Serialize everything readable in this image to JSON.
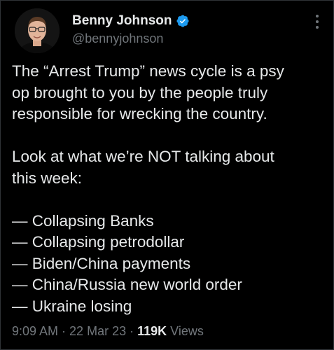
{
  "author": {
    "display_name": "Benny Johnson",
    "handle": "@bennyjohnson",
    "verified": true,
    "verified_color": "#1d9bf0"
  },
  "tweet": {
    "paragraph1": [
      "The “Arrest Trump” news cycle is a psy",
      "op brought to you by the people truly",
      "responsible for wrecking the country."
    ],
    "paragraph2": [
      "Look at what we’re NOT talking about",
      "this week:"
    ],
    "list_items": [
      "— Collapsing Banks",
      "— Collapsing petrodollar",
      "— Biden/China payments",
      "— China/Russia new world order",
      "— Ukraine losing"
    ]
  },
  "meta": {
    "time": "9:09 AM",
    "separator": "·",
    "date": "22 Mar 23",
    "views_count": "119K",
    "views_label": "Views"
  },
  "icons": {
    "verified": "verified-badge-icon",
    "more": "more-options-icon"
  },
  "colors": {
    "background": "#000000",
    "text": "#e7e9ea",
    "secondary": "#71767b"
  }
}
